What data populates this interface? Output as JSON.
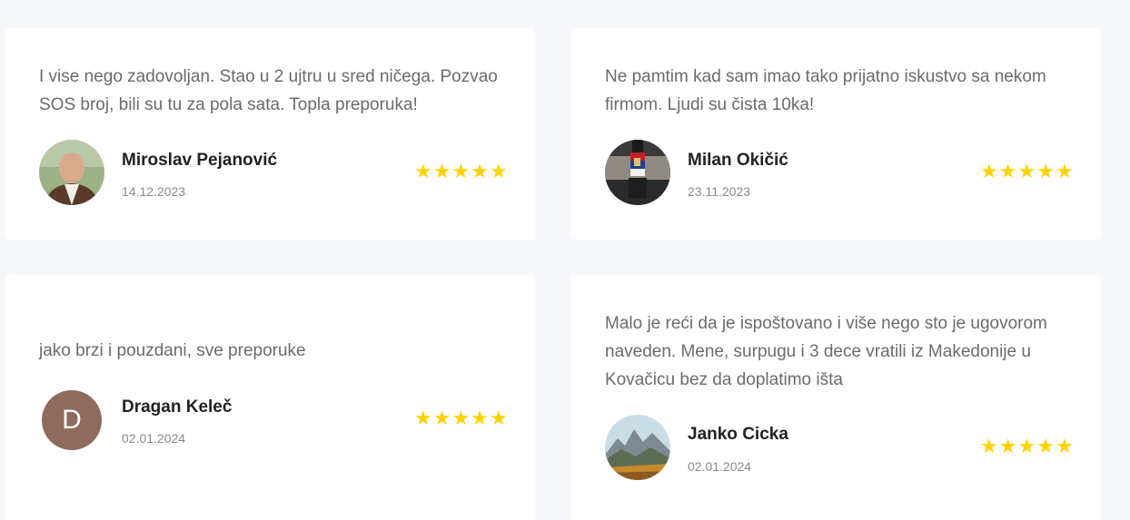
{
  "reviews": [
    {
      "text": "I vise nego zadovoljan. Stao u 2 ujtru u sred ničega. Pozvao SOS broj, bili su tu za pola sata. Topla preporuka!",
      "name": "Miroslav Pejanović",
      "date": "14.12.2023",
      "rating": 5
    },
    {
      "text": "Ne pamtim kad sam imao tako prijatno iskustvo sa nekom firmom. Ljudi su čista 10ka!",
      "name": "Milan Okičić",
      "date": "23.11.2023",
      "rating": 5
    },
    {
      "text": "jako brzi i pouzdani, sve preporuke",
      "name": "Dragan Keleč",
      "date": "02.01.2024",
      "rating": 5,
      "avatar_initial": "D"
    },
    {
      "text": "Malo je reći da je ispoštovano i više nego sto je ugovorom naveden. Mene, surpugu i 3 dece vratili iz Makedonije u Kovačicu bez da doplatimo išta",
      "name": "Janko Cicka",
      "date": "02.01.2024",
      "rating": 5
    }
  ],
  "colors": {
    "page_background": "#f6f7fb",
    "card_background": "#ffffff",
    "star": "#ffd200",
    "review_text": "#6b6b6b",
    "name_text": "#222222",
    "date_text": "#8a8a8a",
    "initial_avatar": "#8f6a5d"
  },
  "icons": {
    "star": "star-icon"
  }
}
